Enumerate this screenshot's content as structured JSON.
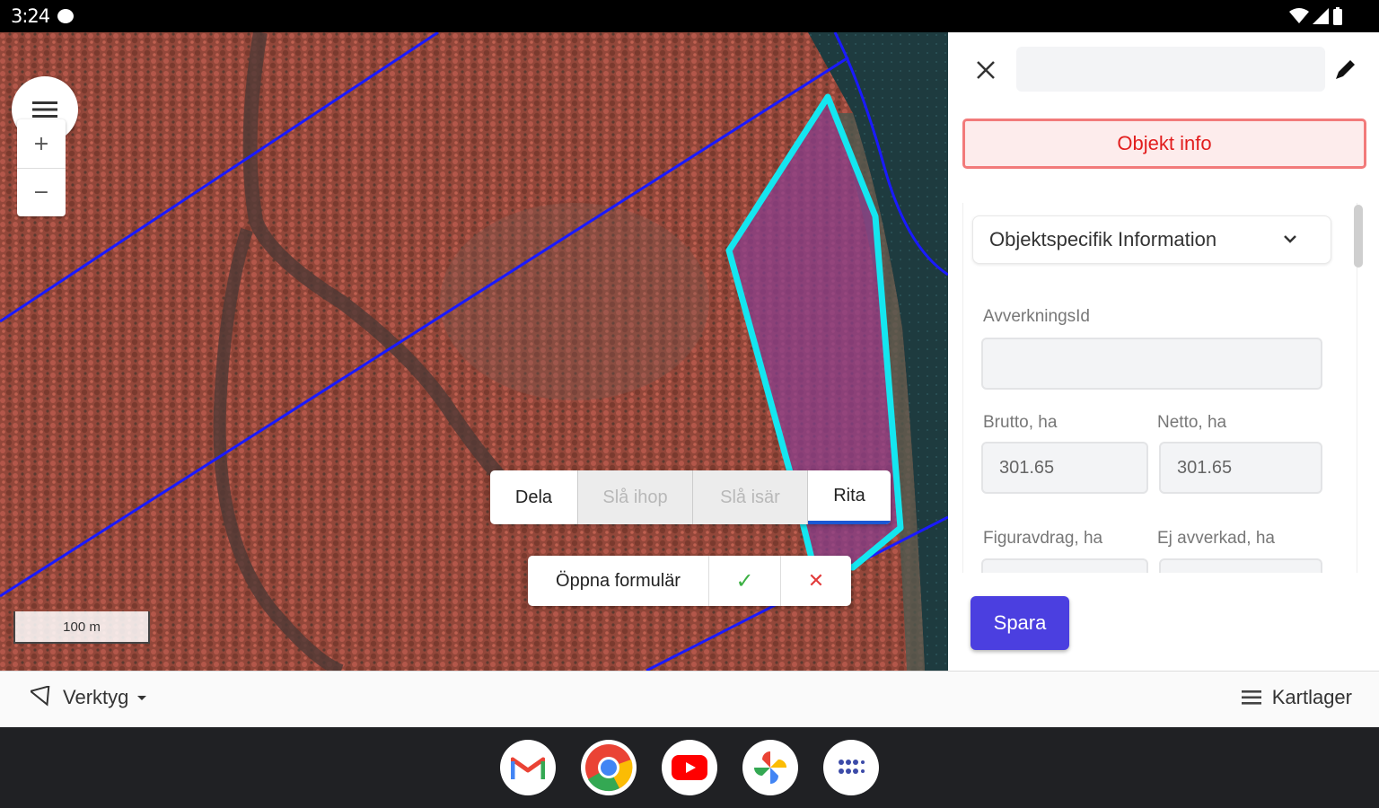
{
  "status_bar": {
    "time": "3:24"
  },
  "map": {
    "zoom_in_label": "+",
    "zoom_out_label": "−",
    "scale_label": "100 m"
  },
  "edit_toolbar": {
    "split_label": "Dela",
    "merge_label": "Slå ihop",
    "separate_label": "Slå isär",
    "draw_label": "Rita"
  },
  "form_toolbar": {
    "open_form_label": "Öppna formulär",
    "confirm_symbol": "✓",
    "cancel_symbol": "✕"
  },
  "panel": {
    "title_value": "",
    "tab_label": "Objekt info",
    "section_title": "Objektspecifik Information",
    "fields": {
      "avverkningsid_label": "AvverkningsId",
      "avverkningsid_value": "",
      "brutto_label": "Brutto, ha",
      "brutto_value": "301.65",
      "netto_label": "Netto, ha",
      "netto_value": "301.65",
      "figuravdrag_label": "Figuravdrag, ha",
      "ej_avverkad_label": "Ej avverkad, ha"
    },
    "save_label": "Spara"
  },
  "bottom_bar": {
    "tools_label": "Verktyg",
    "layers_label": "Kartlager"
  },
  "colors": {
    "parcel_line": "#1a1aff",
    "selection_outline": "#14e6f0",
    "save_button": "#4b3fe0",
    "tab_text": "#e21d1d"
  },
  "dock_apps": [
    "gmail-icon",
    "chrome-icon",
    "youtube-icon",
    "photos-icon",
    "app-drawer-icon"
  ]
}
